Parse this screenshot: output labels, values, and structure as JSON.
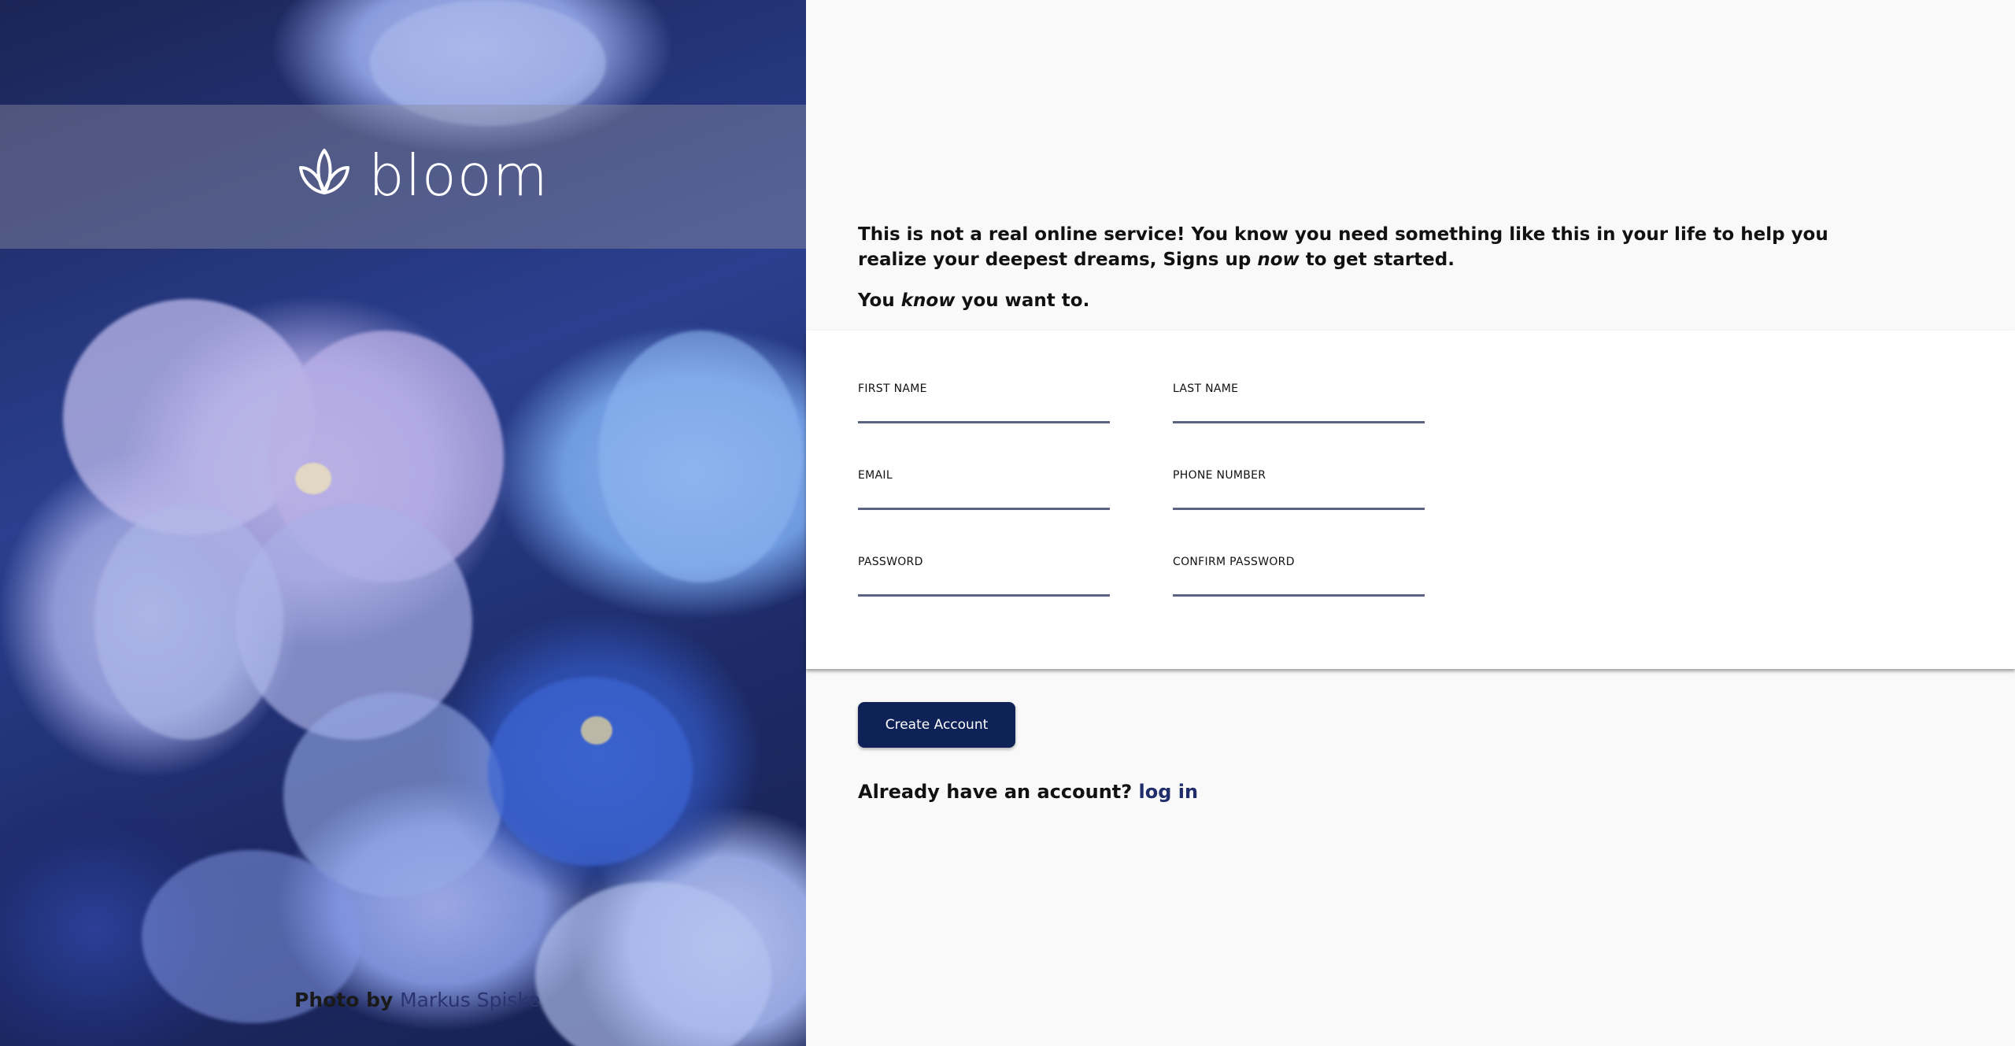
{
  "brand": {
    "name": "bloom",
    "logo_icon": "lotus-icon"
  },
  "credit": {
    "prefix": "Photo by",
    "author": "Markus Spiske"
  },
  "intro": {
    "line1_part1": "This is not a real online service! You know you need something like this in your life to help you realize your deepest dreams, Signs up ",
    "line1_emph": "now",
    "line1_part2": " to get started.",
    "line2_part1": "You ",
    "line2_emph": "know",
    "line2_part2": " you want to."
  },
  "form": {
    "first_name_label": "FIRST NAME",
    "last_name_label": "LAST NAME",
    "email_label": "EMAIL",
    "phone_label": "PHONE NUMBER",
    "password_label": "PASSWORD",
    "confirm_password_label": "CONFIRM PASSWORD",
    "first_name_value": "",
    "last_name_value": "",
    "email_value": "",
    "phone_value": "",
    "password_value": "",
    "confirm_password_value": ""
  },
  "actions": {
    "create_account_label": "Create Account",
    "already_text": "Already have an account?",
    "login_label": "log in"
  },
  "colors": {
    "accent": "#0f2258",
    "link": "#1f2d6b",
    "input_underline": "#5a6480",
    "page_bg": "#f9f9f9",
    "panel_bg": "#ffffff"
  }
}
